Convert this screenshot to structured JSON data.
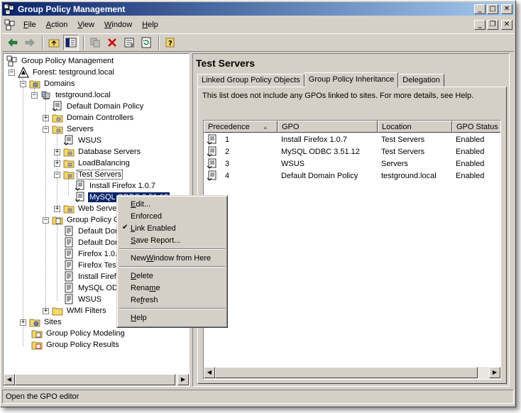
{
  "window": {
    "title": "Group Policy Management"
  },
  "menubar": {
    "items": [
      {
        "key": "F",
        "rest": "ile"
      },
      {
        "key": "A",
        "rest": "ction"
      },
      {
        "key": "V",
        "rest": "iew"
      },
      {
        "key": "W",
        "rest": "indow"
      },
      {
        "key": "H",
        "rest": "elp"
      }
    ]
  },
  "tree": {
    "root": "Group Policy Management",
    "forest": "Forest: testground.local",
    "domains": "Domains",
    "domain": "testground.local",
    "default_domain_policy": "Default Domain Policy",
    "domain_controllers": "Domain Controllers",
    "servers": "Servers",
    "wsus": "WSUS",
    "database_servers": "Database Servers",
    "loadbalancing": "LoadBalancing",
    "test_servers": "Test Servers",
    "install_firefox": "Install Firefox 1.0.7",
    "mysql_selected": "MySQL ODBC 3.51.12",
    "web_servers": "Web Servers",
    "group_policy_objects": "Group Policy Objects",
    "gpo1": "Default Domain Controllers Policy",
    "gpo2": "Default Domain Policy",
    "gpo3": "Firefox 1.0.7",
    "gpo4": "Firefox Test",
    "gpo5": "Install Firefox 1.0.7",
    "gpo6": "MySQL ODBC 3.51.12",
    "gpo7": "WSUS",
    "wmi_filters": "WMI Filters",
    "sites": "Sites",
    "modeling": "Group Policy Modeling",
    "results": "Group Policy Results"
  },
  "right": {
    "title": "Test Servers",
    "tabs": [
      "Linked Group Policy Objects",
      "Group Policy Inheritance",
      "Delegation"
    ],
    "info": "This list does not include any GPOs linked to sites. For more details, see Help.",
    "columns": [
      "Precedence",
      "GPO",
      "Location",
      "GPO Status"
    ],
    "rows": [
      {
        "precedence": "1",
        "gpo": "Install Firefox 1.0.7",
        "location": "Test Servers",
        "status": "Enabled"
      },
      {
        "precedence": "2",
        "gpo": "MySQL ODBC 3.51.12",
        "location": "Test Servers",
        "status": "Enabled"
      },
      {
        "precedence": "3",
        "gpo": "WSUS",
        "location": "Servers",
        "status": "Enabled"
      },
      {
        "precedence": "4",
        "gpo": "Default Domain Policy",
        "location": "testground.local",
        "status": "Enabled"
      }
    ]
  },
  "context_menu": {
    "edit": {
      "key": "E",
      "rest": "dit..."
    },
    "enforced": {
      "key": "",
      "rest": "Enforced"
    },
    "link_enabled": {
      "key": "L",
      "rest": "ink Enabled"
    },
    "save_report": {
      "key": "S",
      "rest": "ave Report..."
    },
    "new_window": {
      "pre": "New ",
      "key": "W",
      "rest": "indow from Here"
    },
    "delete": {
      "key": "D",
      "rest": "elete"
    },
    "rename": {
      "pre": "Rena",
      "key": "m",
      "rest": "e"
    },
    "refresh": {
      "pre": "Re",
      "key": "f",
      "rest": "resh"
    },
    "help": {
      "key": "H",
      "rest": "elp"
    }
  },
  "statusbar": {
    "text": "Open the GPO editor"
  },
  "colors": {
    "titlebar_start": "#0a246a",
    "titlebar_end": "#a6caf0",
    "selection": "#0a246a",
    "face": "#d4d0c8"
  }
}
